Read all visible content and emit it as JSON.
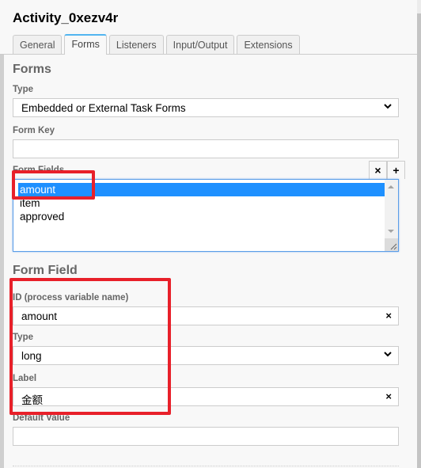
{
  "header": {
    "title": "Activity_0xezv4r"
  },
  "tabs": [
    {
      "label": "General",
      "active": false
    },
    {
      "label": "Forms",
      "active": true
    },
    {
      "label": "Listeners",
      "active": false
    },
    {
      "label": "Input/Output",
      "active": false
    },
    {
      "label": "Extensions",
      "active": false
    }
  ],
  "forms": {
    "section_title": "Forms",
    "type_label": "Type",
    "type_value": "Embedded or External Task Forms",
    "form_key_label": "Form Key",
    "form_key_value": "",
    "form_fields_label": "Form Fields",
    "remove_button": "×",
    "add_button": "+",
    "form_fields": [
      {
        "label": "amount",
        "selected": true
      },
      {
        "label": "item",
        "selected": false
      },
      {
        "label": "approved",
        "selected": false
      }
    ]
  },
  "form_field": {
    "section_title": "Form Field",
    "id_label": "ID (process variable name)",
    "id_value": "amount",
    "type_label": "Type",
    "type_value": "long",
    "label_label": "Label",
    "label_value": "金额",
    "default_value_label": "Default Value",
    "default_value": "",
    "clear_glyph": "×"
  },
  "annotations": {
    "highlight_color": "#e8202a"
  }
}
